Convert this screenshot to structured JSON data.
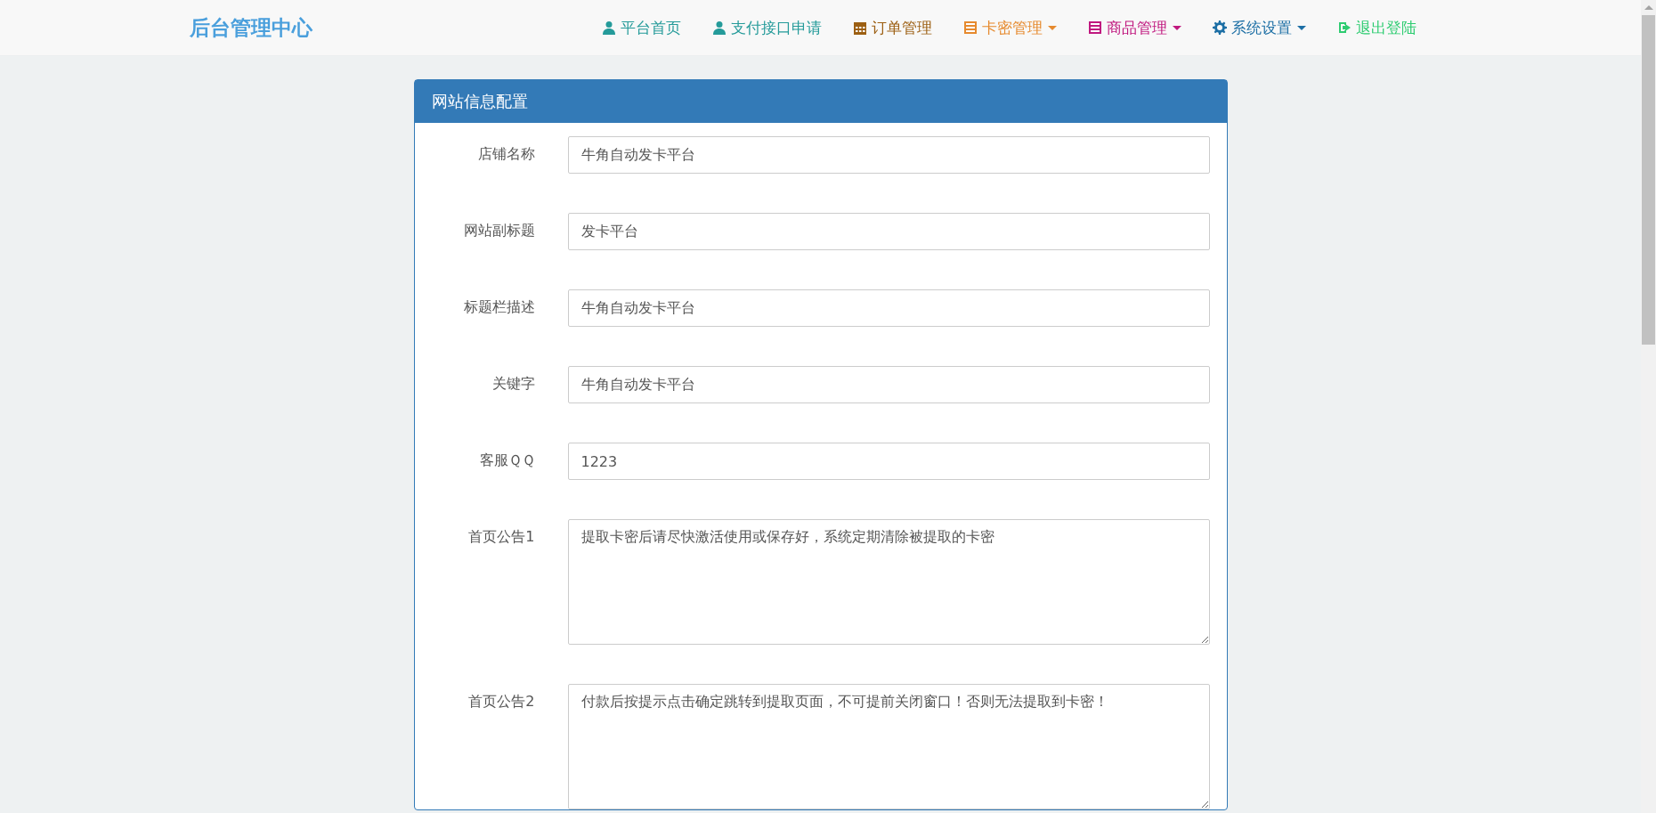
{
  "brand": "后台管理中心",
  "nav": [
    {
      "label": "平台首页",
      "color": "#259b9a",
      "dropdown": false
    },
    {
      "label": "支付接口申请",
      "color": "#259b9a",
      "dropdown": false
    },
    {
      "label": "订单管理",
      "color": "#9c5f12",
      "dropdown": false
    },
    {
      "label": "卡密管理",
      "color": "#e68a2e",
      "dropdown": true
    },
    {
      "label": "商品管理",
      "color": "#c0187f",
      "dropdown": true
    },
    {
      "label": "系统设置",
      "color": "#1d6fa5",
      "dropdown": true
    },
    {
      "label": "退出登陆",
      "color": "#2ecc71",
      "dropdown": false
    }
  ],
  "panel": {
    "title": "网站信息配置",
    "fields": [
      {
        "kind": "input",
        "label": "店铺名称",
        "value": "牛角自动发卡平台"
      },
      {
        "kind": "input",
        "label": "网站副标题",
        "value": "发卡平台"
      },
      {
        "kind": "input",
        "label": "标题栏描述",
        "value": "牛角自动发卡平台"
      },
      {
        "kind": "input",
        "label": "关键字",
        "value": "牛角自动发卡平台"
      },
      {
        "kind": "input",
        "label": "客服ＱＱ",
        "value": "1223"
      },
      {
        "kind": "textarea",
        "label": "首页公告1",
        "value": "提取卡密后请尽快激活使用或保存好，系统定期清除被提取的卡密"
      },
      {
        "kind": "textarea",
        "label": "首页公告2",
        "value": "付款后按提示点击确定跳转到提取页面，不可提前关闭窗口！否则无法提取到卡密！"
      }
    ]
  }
}
